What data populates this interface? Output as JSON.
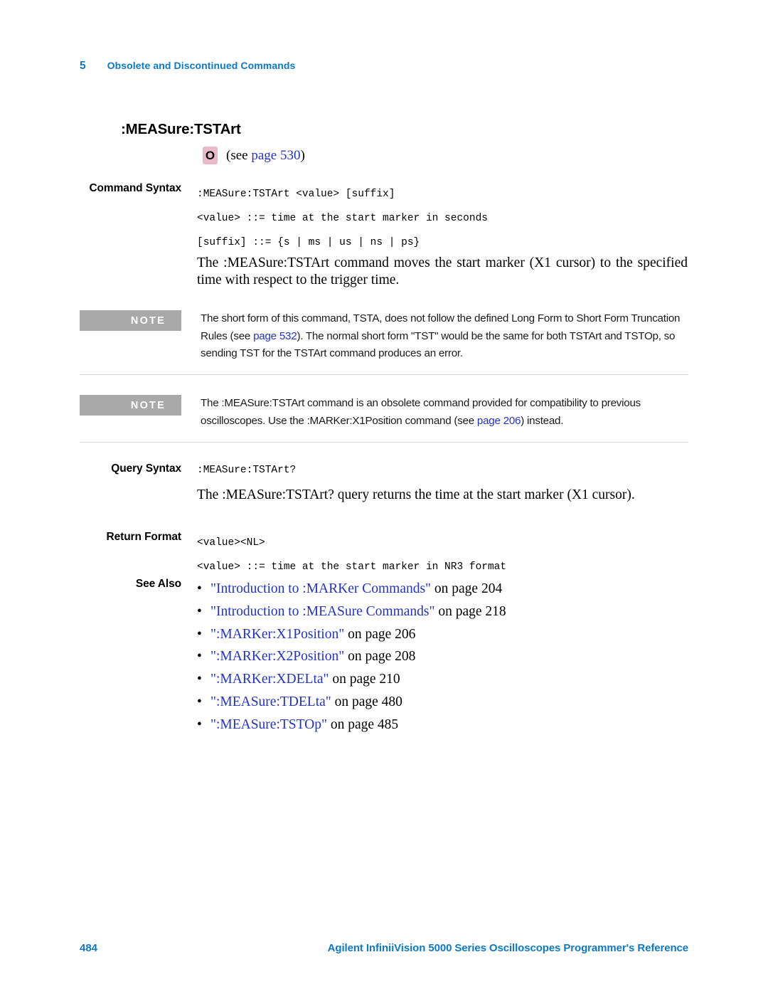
{
  "header": {
    "chapter_number": "5",
    "chapter_title": "Obsolete and Discontinued Commands"
  },
  "command": {
    "title": ":MEASure:TSTArt",
    "badge_letter": "O",
    "see_prefix": "(see ",
    "see_link": "page",
    "see_page": "530",
    "see_suffix": ")"
  },
  "command_syntax": {
    "label": "Command Syntax",
    "lines": [
      ":MEASure:TSTArt <value> [suffix]",
      "<value> ::= time at the start marker in seconds",
      "[suffix] ::= {s | ms | us | ns | ps}"
    ],
    "description": "The :MEASure:TSTArt command moves the start marker (X1 cursor) to the specified time with respect to the trigger time."
  },
  "note_1": {
    "badge": "NOTE",
    "text_part_1": "The short form of this command, TSTA, does not follow the defined Long Form to Short Form Truncation Rules (see ",
    "link_text": "page 532",
    "text_part_2": "). The normal short form \"TST\" would be the same for both TSTArt and TSTOp, so sending TST for the TSTArt command produces an error."
  },
  "note_2": {
    "badge": "NOTE",
    "text_part_1": "The :MEASure:TSTArt command is an obsolete command provided for compatibility to previous oscilloscopes. Use the :MARKer:X1Position command (see ",
    "link_text": "page 206",
    "text_part_2": ") instead."
  },
  "query_syntax": {
    "label": "Query Syntax",
    "line": ":MEASure:TSTArt?",
    "description": "The :MEASure:TSTArt? query returns the time at the start marker (X1 cursor)."
  },
  "return_format": {
    "label": "Return Format",
    "lines": [
      "<value><NL>",
      "<value> ::= time at the start marker in NR3 format"
    ]
  },
  "see_also": {
    "label": "See Also",
    "bullet_glyph": "•",
    "items": [
      {
        "link": "\"Introduction to :MARKer Commands\"",
        "suffix": " on page 204"
      },
      {
        "link": "\"Introduction to :MEASure Commands\"",
        "suffix": " on page 218"
      },
      {
        "link": "\":MARKer:X1Position\"",
        "suffix": " on page 206"
      },
      {
        "link": "\":MARKer:X2Position\"",
        "suffix": " on page 208"
      },
      {
        "link": "\":MARKer:XDELta\"",
        "suffix": " on page 210"
      },
      {
        "link": "\":MEASure:TDELta\"",
        "suffix": " on page 480"
      },
      {
        "link": "\":MEASure:TSTOp\"",
        "suffix": " on page 485"
      }
    ]
  },
  "footer": {
    "page_number": "484",
    "document_title": "Agilent InfiniiVision 5000 Series Oscilloscopes Programmer's Reference"
  },
  "colors": {
    "brand_blue": "#0d79c4",
    "link_blue": "#2233c4",
    "note_gray": "#a9a9a9",
    "rule_gray": "#d8d8d8",
    "badge_pink": "#eab8c8"
  }
}
